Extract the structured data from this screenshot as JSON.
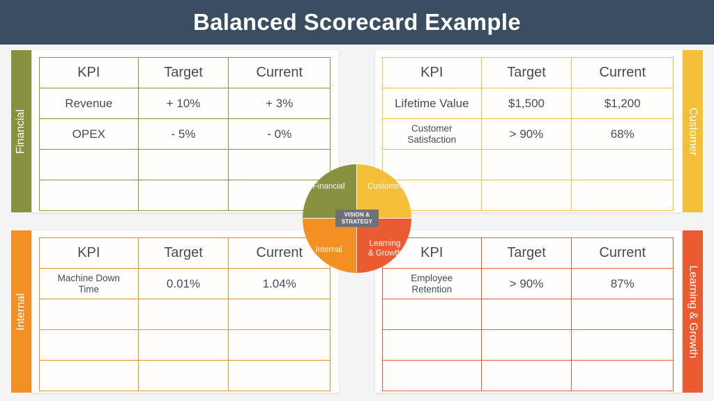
{
  "header": {
    "title": "Balanced Scorecard Example"
  },
  "colors": {
    "header_bg": "#3b4d60",
    "page_bg": "#f4f4f5",
    "financial": "#879140",
    "customer": "#f5c037",
    "internal": "#f29023",
    "learning_growth": "#ea5b31",
    "text": "#424c56",
    "vision_box": "#6e7277"
  },
  "center_wheel": {
    "vision_line1": "VISION &",
    "vision_line2": "STRATEGY",
    "segments": [
      {
        "label": "Financial",
        "color": "#879140"
      },
      {
        "label": "Customer",
        "color": "#f5c037"
      },
      {
        "label": "Internal",
        "color": "#f29023"
      },
      {
        "label": "Learning\n& Growth",
        "color": "#ea5b31"
      }
    ]
  },
  "quadrants": [
    {
      "key": "financial",
      "tab_label": "Financial",
      "color": "#879140",
      "columns": [
        "KPI",
        "Target",
        "Current"
      ],
      "rows": [
        {
          "kpi": "Revenue",
          "target": "+ 10%",
          "current": "+ 3%",
          "multiline": false
        },
        {
          "kpi": "OPEX",
          "target": "- 5%",
          "current": "- 0%",
          "multiline": false
        },
        {
          "kpi": "",
          "target": "",
          "current": "",
          "multiline": false
        },
        {
          "kpi": "",
          "target": "",
          "current": "",
          "multiline": false
        }
      ]
    },
    {
      "key": "customer",
      "tab_label": "Customer",
      "color": "#f5c037",
      "columns": [
        "KPI",
        "Target",
        "Current"
      ],
      "rows": [
        {
          "kpi": "Lifetime Value",
          "target": "$1,500",
          "current": "$1,200",
          "multiline": false
        },
        {
          "kpi": "Customer\nSatisfaction",
          "target": "> 90%",
          "current": "68%",
          "multiline": true
        },
        {
          "kpi": "",
          "target": "",
          "current": "",
          "multiline": false
        },
        {
          "kpi": "",
          "target": "",
          "current": "",
          "multiline": false
        }
      ]
    },
    {
      "key": "internal",
      "tab_label": "Internal",
      "color": "#f29023",
      "columns": [
        "KPI",
        "Target",
        "Current"
      ],
      "rows": [
        {
          "kpi": "Machine Down\nTime",
          "target": "0.01%",
          "current": "1.04%",
          "multiline": true
        },
        {
          "kpi": "",
          "target": "",
          "current": "",
          "multiline": false
        },
        {
          "kpi": "",
          "target": "",
          "current": "",
          "multiline": false
        },
        {
          "kpi": "",
          "target": "",
          "current": "",
          "multiline": false
        }
      ]
    },
    {
      "key": "learning_growth",
      "tab_label": "Learning & Growth",
      "color": "#ea5b31",
      "columns": [
        "KPI",
        "Target",
        "Current"
      ],
      "rows": [
        {
          "kpi": "Employee\nRetention",
          "target": "> 90%",
          "current": "87%",
          "multiline": true
        },
        {
          "kpi": "",
          "target": "",
          "current": "",
          "multiline": false
        },
        {
          "kpi": "",
          "target": "",
          "current": "",
          "multiline": false
        },
        {
          "kpi": "",
          "target": "",
          "current": "",
          "multiline": false
        }
      ]
    }
  ]
}
